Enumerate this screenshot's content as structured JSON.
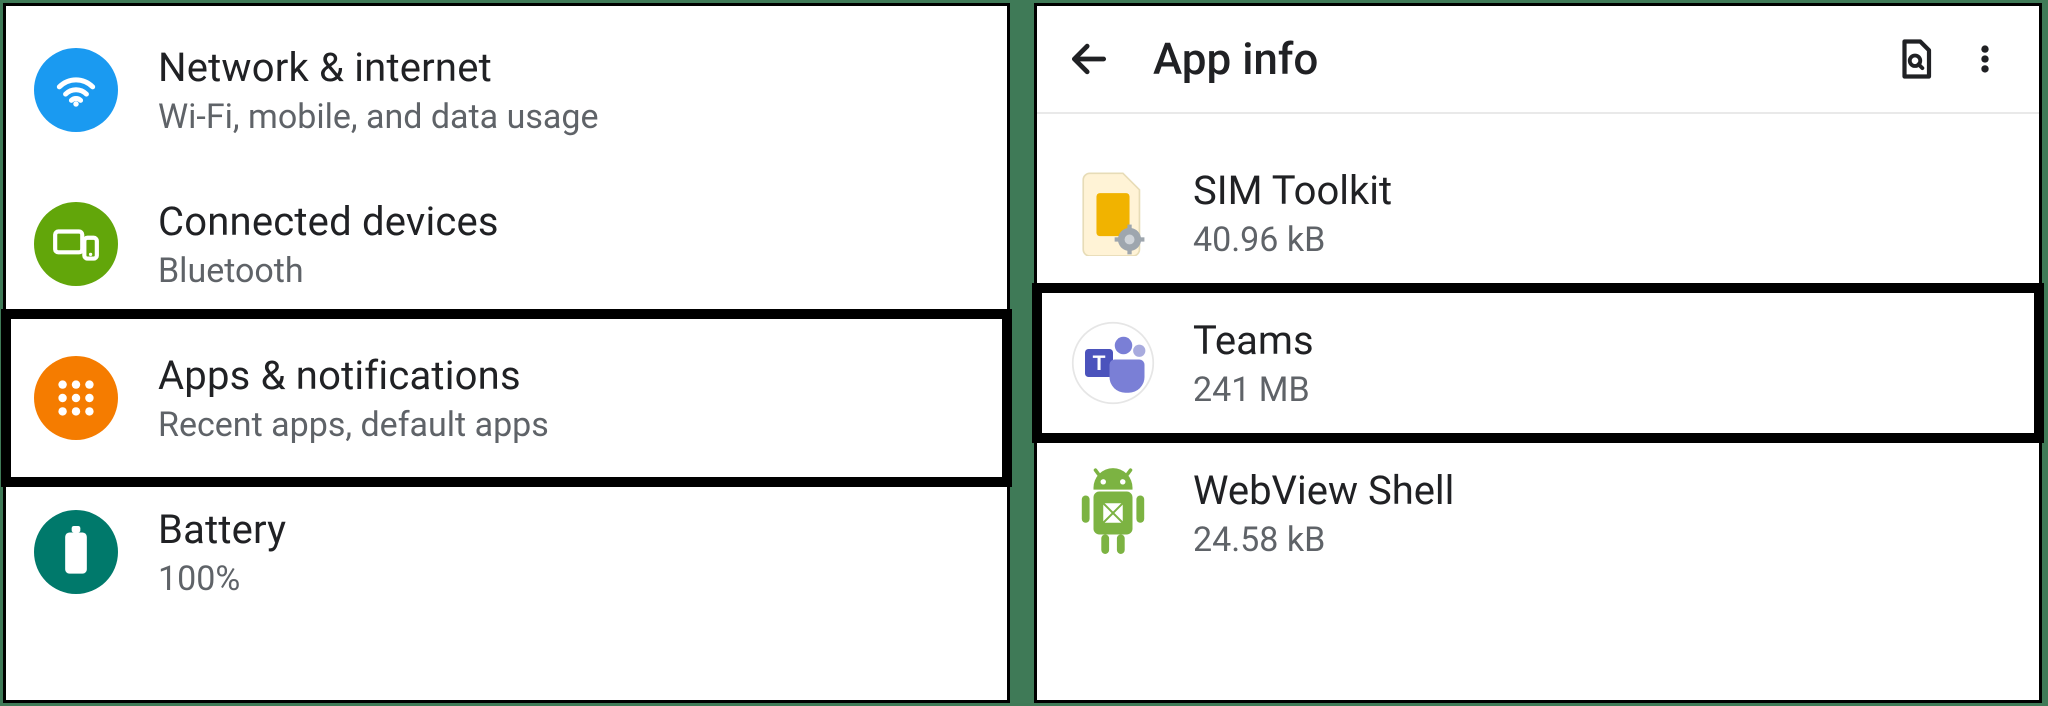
{
  "left": {
    "items": [
      {
        "title": "Network & internet",
        "sub": "Wi-Fi, mobile, and data usage"
      },
      {
        "title": "Connected devices",
        "sub": "Bluetooth"
      },
      {
        "title": "Apps & notifications",
        "sub": "Recent apps, default apps"
      },
      {
        "title": "Battery",
        "sub": "100%"
      }
    ]
  },
  "right": {
    "header": {
      "title": "App info"
    },
    "apps": [
      {
        "name": "SIM Toolkit",
        "size": "40.96 kB"
      },
      {
        "name": "Teams",
        "size": "241 MB"
      },
      {
        "name": "WebView Shell",
        "size": "24.58 kB"
      }
    ]
  },
  "colors": {
    "wifi": "#1a9af1",
    "devices": "#62a60a",
    "apps": "#f57c00",
    "battery": "#00796b",
    "text": "#202124",
    "subtext": "#5f6368"
  }
}
